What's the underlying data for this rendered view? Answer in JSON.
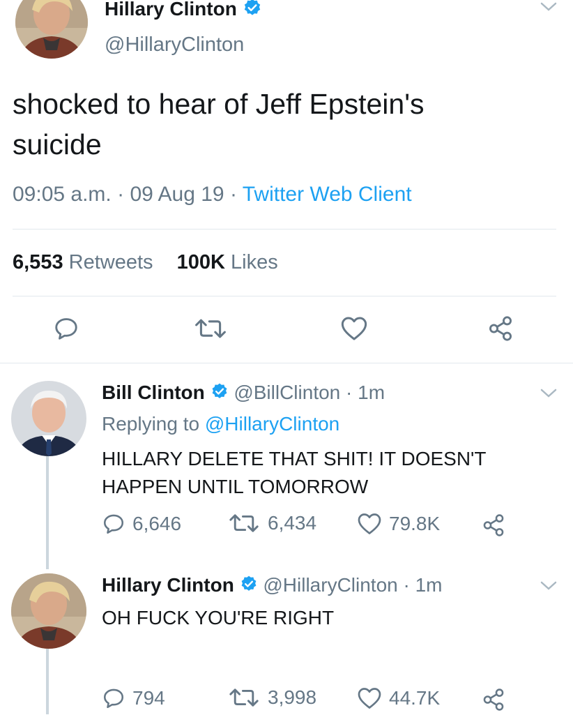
{
  "main_tweet": {
    "display_name": "Hillary Clinton",
    "handle": "@HillaryClinton",
    "text_line1": "shocked to hear of Jeff Epstein's",
    "text_line2": "suicide",
    "time": "09:05 a.m.",
    "sep1": "·",
    "date": "09 Aug 19",
    "sep2": "·",
    "client": "Twitter Web Client",
    "retweets_count": "6,553",
    "retweets_label": "Retweets",
    "likes_count": "100K",
    "likes_label": "Likes"
  },
  "reply1": {
    "display_name": "Bill Clinton",
    "meta": "@BillClinton · 1m",
    "replying_prefix": "Replying to",
    "replying_handle": "@HillaryClinton",
    "text_line1": "HILLARY DELETE THAT SHIT! IT DOESN'T",
    "text_line2": "HAPPEN UNTIL TOMORROW",
    "replies": "6,646",
    "retweets": "6,434",
    "likes": "79.8K"
  },
  "reply2": {
    "display_name": "Hillary Clinton",
    "meta": "@HillaryClinton · 1m",
    "text": "OH FUCK YOU'RE RIGHT",
    "replies": "794",
    "retweets": "3,998",
    "likes": "44.7K"
  },
  "colors": {
    "accent": "#1da1f2",
    "secondary_text": "#657786",
    "divider": "#e1e8ed"
  }
}
